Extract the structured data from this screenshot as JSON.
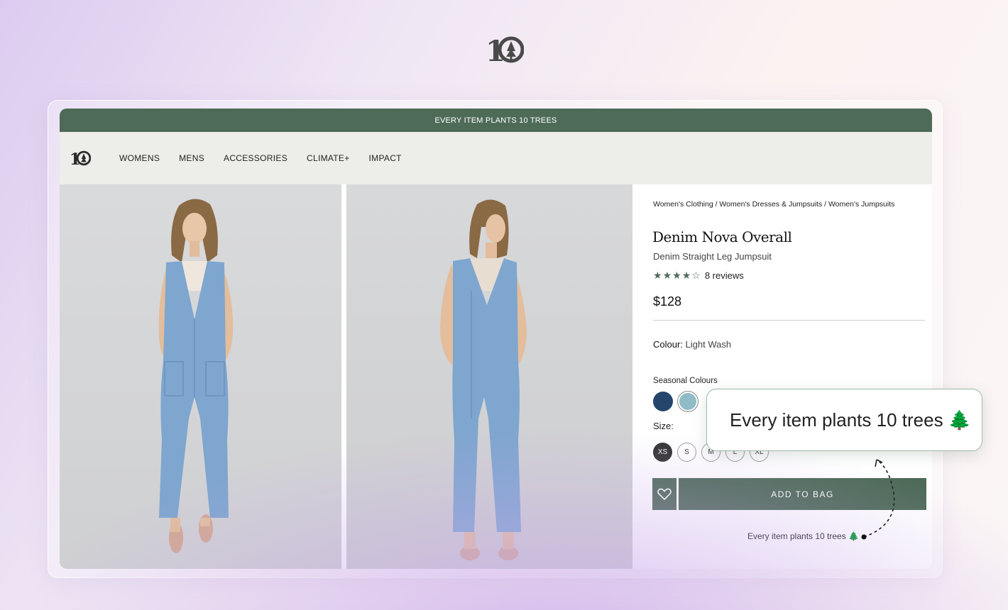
{
  "brand": {
    "logo_text": "10"
  },
  "promo": {
    "text": "EVERY ITEM PLANTS 10 TREES"
  },
  "nav": {
    "logo_text": "10",
    "links": [
      "WOMENS",
      "MENS",
      "ACCESSORIES",
      "CLIMATE+",
      "IMPACT"
    ]
  },
  "product": {
    "breadcrumb": "Women's Clothing / Women's Dresses & Jumpsuits / Women's Jumpsuits",
    "title": "Denim Nova Overall",
    "subtitle": "Denim Straight Leg Jumpsuit",
    "rating": 4,
    "rating_max": 5,
    "reviews_label": "8 reviews",
    "price": "$128",
    "colour_label": "Colour:",
    "colour_value": "Light Wash",
    "seasonal_label": "Seasonal Colours",
    "swatches": [
      {
        "name": "navy",
        "color": "#25456b"
      },
      {
        "name": "light-wash",
        "color": "#8fbcc6"
      }
    ],
    "size_label": "Size:",
    "sizes": [
      "XS",
      "S",
      "M",
      "L",
      "XL"
    ],
    "selected_size": "XS",
    "add_to_bag": "ADD TO BAG",
    "trees_note": "Every item plants 10 trees 🌲"
  },
  "callout": {
    "text": "Every item plants 10 trees 🌲"
  },
  "colors": {
    "accent": "#4e6b58",
    "nav_bg": "#edeee9",
    "denim": "#7ea6cf"
  }
}
